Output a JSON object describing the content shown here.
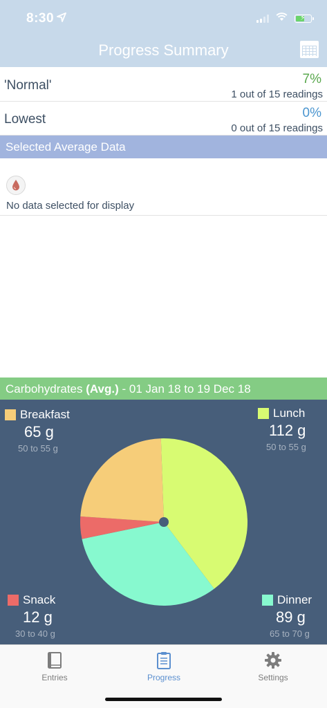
{
  "status_bar": {
    "time": "8:30"
  },
  "header": {
    "title": "Progress Summary"
  },
  "rows": [
    {
      "label": "'Normal'",
      "percent": "7%",
      "detail": "1 out of 15 readings",
      "color": "#5aa84e"
    },
    {
      "label": "Lowest",
      "percent": "0%",
      "detail": "0 out of 15 readings",
      "color": "#4a95cf"
    }
  ],
  "selected_average": {
    "header": "Selected Average Data",
    "empty_message": "No data selected for display"
  },
  "carbs": {
    "header_prefix": "Carbohydrates ",
    "header_bold": "(Avg.)",
    "header_suffix": " - 01 Jan 18 to 19 Dec 18",
    "meals": {
      "breakfast": {
        "name": "Breakfast",
        "value": "65 g",
        "range": "50 to 55 g",
        "color": "#f6cd79"
      },
      "lunch": {
        "name": "Lunch",
        "value": "112 g",
        "range": "50 to 55 g",
        "color": "#d8fb72"
      },
      "snack": {
        "name": "Snack",
        "value": "12 g",
        "range": "30 to 40 g",
        "color": "#ec6b68"
      },
      "dinner": {
        "name": "Dinner",
        "value": "89 g",
        "range": "65 to 70 g",
        "color": "#87f9cf"
      }
    }
  },
  "chart_data": {
    "type": "pie",
    "categories": [
      "Lunch",
      "Dinner",
      "Snack",
      "Breakfast"
    ],
    "values": [
      112,
      89,
      12,
      65
    ],
    "colors": [
      "#d8fb72",
      "#87f9cf",
      "#ec6b68",
      "#f6cd79"
    ],
    "start_angle_deg": -2
  },
  "tabs": [
    {
      "label": "Entries",
      "icon": "book-icon"
    },
    {
      "label": "Progress",
      "icon": "clipboard-icon",
      "active": true
    },
    {
      "label": "Settings",
      "icon": "gear-icon"
    }
  ]
}
